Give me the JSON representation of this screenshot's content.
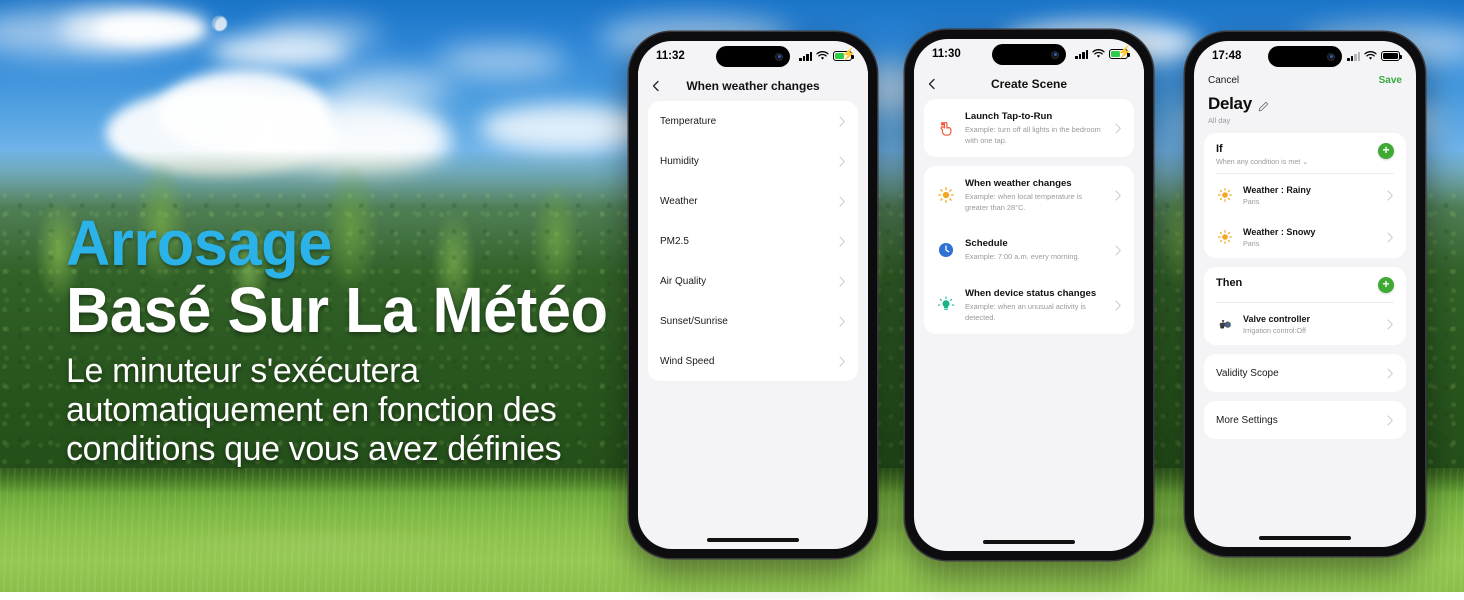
{
  "poster": {
    "headline_line1": "Arrosage",
    "headline_line2": "Basé Sur La Météo",
    "subtitle": "Le minuteur s'exécutera automatiquement en fonction des conditions que vous avez définies",
    "accent_color": "#2bb2e8",
    "headline_color": "#ffffff",
    "green_accent": "#3eaa34"
  },
  "phone1": {
    "status": {
      "time": "11:32",
      "signal": "signal-bars-icon",
      "wifi": "wifi-icon",
      "battery": "battery-charging-icon"
    },
    "nav": {
      "back": "back-chevron-icon",
      "title": "When weather changes"
    },
    "items": [
      {
        "label": "Temperature"
      },
      {
        "label": "Humidity"
      },
      {
        "label": "Weather"
      },
      {
        "label": "PM2.5"
      },
      {
        "label": "Air Quality"
      },
      {
        "label": "Sunset/Sunrise"
      },
      {
        "label": "Wind Speed"
      }
    ]
  },
  "phone2": {
    "status": {
      "time": "11:30",
      "signal": "signal-bars-icon",
      "wifi": "wifi-icon",
      "battery": "battery-charging-icon"
    },
    "nav": {
      "back": "back-chevron-icon",
      "title": "Create Scene"
    },
    "scenes": [
      {
        "icon": "tap-to-run-icon",
        "title": "Launch Tap-to-Run",
        "desc": "Example: turn off all lights in the bedroom with one tap."
      },
      {
        "icon": "sun-icon",
        "title": "When weather changes",
        "desc": "Example: when local temperature is greater than 28°C."
      },
      {
        "icon": "clock-icon",
        "title": "Schedule",
        "desc": "Example: 7:00 a.m. every morning."
      },
      {
        "icon": "bulb-icon",
        "title": "When device status changes",
        "desc": "Example: when an unusual activity is detected."
      }
    ]
  },
  "phone3": {
    "status": {
      "time": "17:48",
      "signal": "signal-bars-icon",
      "wifi": "wifi-icon",
      "battery": "battery-full-icon"
    },
    "bar": {
      "cancel": "Cancel",
      "save": "Save"
    },
    "header": {
      "title": "Delay",
      "edit_icon": "pencil-icon",
      "subtitle": "All day"
    },
    "if_section": {
      "name": "If",
      "condition_mode": "When any condition is met ⌄",
      "add": "add-condition-button",
      "conditions": [
        {
          "icon": "sun-icon",
          "title": "Weather : Rainy",
          "sub": "Paris"
        },
        {
          "icon": "sun-icon",
          "title": "Weather : Snowy",
          "sub": "Paris"
        }
      ]
    },
    "then_section": {
      "name": "Then",
      "add": "add-action-button",
      "actions": [
        {
          "icon": "valve-icon",
          "title": "Valve controller",
          "sub": "Irrigation control:Off"
        }
      ]
    },
    "settings": [
      {
        "label": "Validity Scope"
      },
      {
        "label": "More Settings"
      }
    ]
  }
}
